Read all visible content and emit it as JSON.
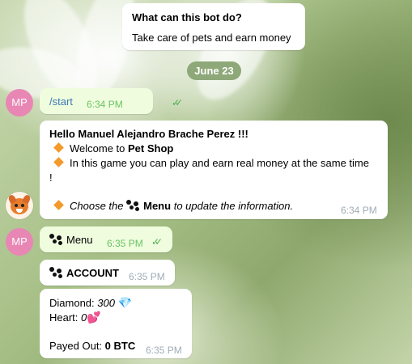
{
  "intro": {
    "title": "What can this bot do?",
    "text": "Take care of pets and earn money"
  },
  "date_badge": "June 23",
  "user_avatar_initials": "MP",
  "messages": {
    "start": {
      "text": "/start",
      "time": "6:34 PM"
    },
    "greeting": {
      "hello": "Hello Manuel Alejandro Brache Perez !!!",
      "welcome_prefix": "Welcome to ",
      "welcome_shop": "Pet Shop",
      "line2": "In this game you can play and earn real money at the same time",
      "line2_end": "!",
      "choose_prefix": "Choose the",
      "choose_menu": "Menu",
      "choose_suffix": "to update the information.",
      "time": "6:34 PM"
    },
    "menu": {
      "text": "Menu",
      "time": "6:35 PM"
    },
    "account": {
      "text": "ACCOUNT",
      "time": "6:35 PM"
    },
    "stats": {
      "diamond_label": "Diamond:",
      "diamond_value": "300",
      "heart_label": "Heart:",
      "heart_value": "0",
      "payed_label": "Payed Out:",
      "payed_value": "0 BTC",
      "time": "6:35 PM"
    }
  },
  "colors": {
    "incoming_bubble": "#ffffff",
    "outgoing_bubble": "#effdde",
    "avatar": "#e886b4",
    "date_badge": "#8ea879",
    "check": "#4fae4e",
    "diamond_emoji": "#f39a2b"
  },
  "icons": [
    "double-check-icon",
    "orange-diamond-icon",
    "paw-prints-icon",
    "blue-gem-icon",
    "pink-heart-icon",
    "bot-avatar-icon"
  ]
}
